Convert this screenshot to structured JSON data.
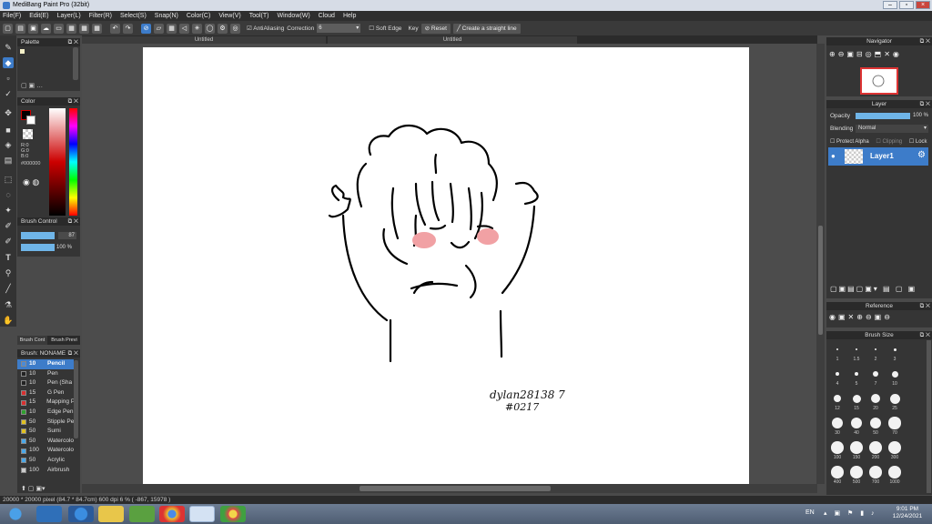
{
  "app": {
    "title": "MediBang Paint Pro (32bit)"
  },
  "menu": [
    "File(F)",
    "Edit(E)",
    "Layer(L)",
    "Filter(R)",
    "Select(S)",
    "Snap(N)",
    "Color(C)",
    "View(V)",
    "Tool(T)",
    "Window(W)",
    "Cloud",
    "Help"
  ],
  "toolbar": {
    "antialiasing": "AntiAliasing",
    "correction_label": "Correction",
    "correction_value": "6",
    "soft_edge": "Soft Edge",
    "key": "Key",
    "reset": "Reset",
    "straight_line": "Create a straight line"
  },
  "tabs": [
    "Untitled",
    "Untitled"
  ],
  "panels": {
    "palette": "Palette",
    "color": "Color",
    "brush_control": "Brush Control",
    "brush_list": "Brush: NONAME",
    "navigator": "Navigator",
    "layer": "Layer",
    "reference": "Reference",
    "brush_size": "Brush Size"
  },
  "color": {
    "r": "R:0",
    "g": "G:0",
    "b": "B:0",
    "hex": "#000000"
  },
  "brush_control": {
    "size": "87",
    "opacity": "100 %"
  },
  "brush_tabs": [
    "Brush Cont",
    "Brush Previ"
  ],
  "brushes": [
    {
      "size": "10",
      "name": "Pencil",
      "color": "#4a8ad8",
      "selected": true
    },
    {
      "size": "10",
      "name": "Pen",
      "color": "#222222"
    },
    {
      "size": "10",
      "name": "Pen (Sha",
      "color": "#222222"
    },
    {
      "size": "15",
      "name": "G Pen",
      "color": "#d83030"
    },
    {
      "size": "15",
      "name": "Mapping P",
      "color": "#d83030"
    },
    {
      "size": "10",
      "name": "Edge Pen",
      "color": "#30a030"
    },
    {
      "size": "50",
      "name": "Stipple Pe",
      "color": "#e0c020"
    },
    {
      "size": "50",
      "name": "Sumi",
      "color": "#e0c020"
    },
    {
      "size": "50",
      "name": "Watercolo",
      "color": "#4aa8e8"
    },
    {
      "size": "100",
      "name": "Watercolo",
      "color": "#4aa8e8"
    },
    {
      "size": "50",
      "name": "Acrylic",
      "color": "#4aa8e8"
    },
    {
      "size": "100",
      "name": "Airbrush",
      "color": "#cccccc"
    }
  ],
  "layer": {
    "opacity_label": "Opacity",
    "opacity_value": "100 %",
    "blending_label": "Blending",
    "blending_value": "Normal",
    "protect_alpha": "Protect Alpha",
    "clipping": "Clipping",
    "lock": "Lock",
    "layer_name": "Layer1"
  },
  "brush_sizes": [
    "1",
    "1.5",
    "2",
    "3",
    "4",
    "5",
    "7",
    "10",
    "12",
    "15",
    "20",
    "25",
    "30",
    "40",
    "50",
    "70",
    "100",
    "150",
    "200",
    "300",
    "400",
    "500",
    "700",
    "1000"
  ],
  "status": "20000 * 20000 pixel  (84.7 * 84.7cm)  600 dpi  6 %  ( -867, 15978 )",
  "canvas_text": {
    "line1": "dylan28138 7",
    "line2": "#0217"
  },
  "taskbar": {
    "lang": "EN",
    "time": "9:01 PM",
    "date": "12/24/2021"
  }
}
